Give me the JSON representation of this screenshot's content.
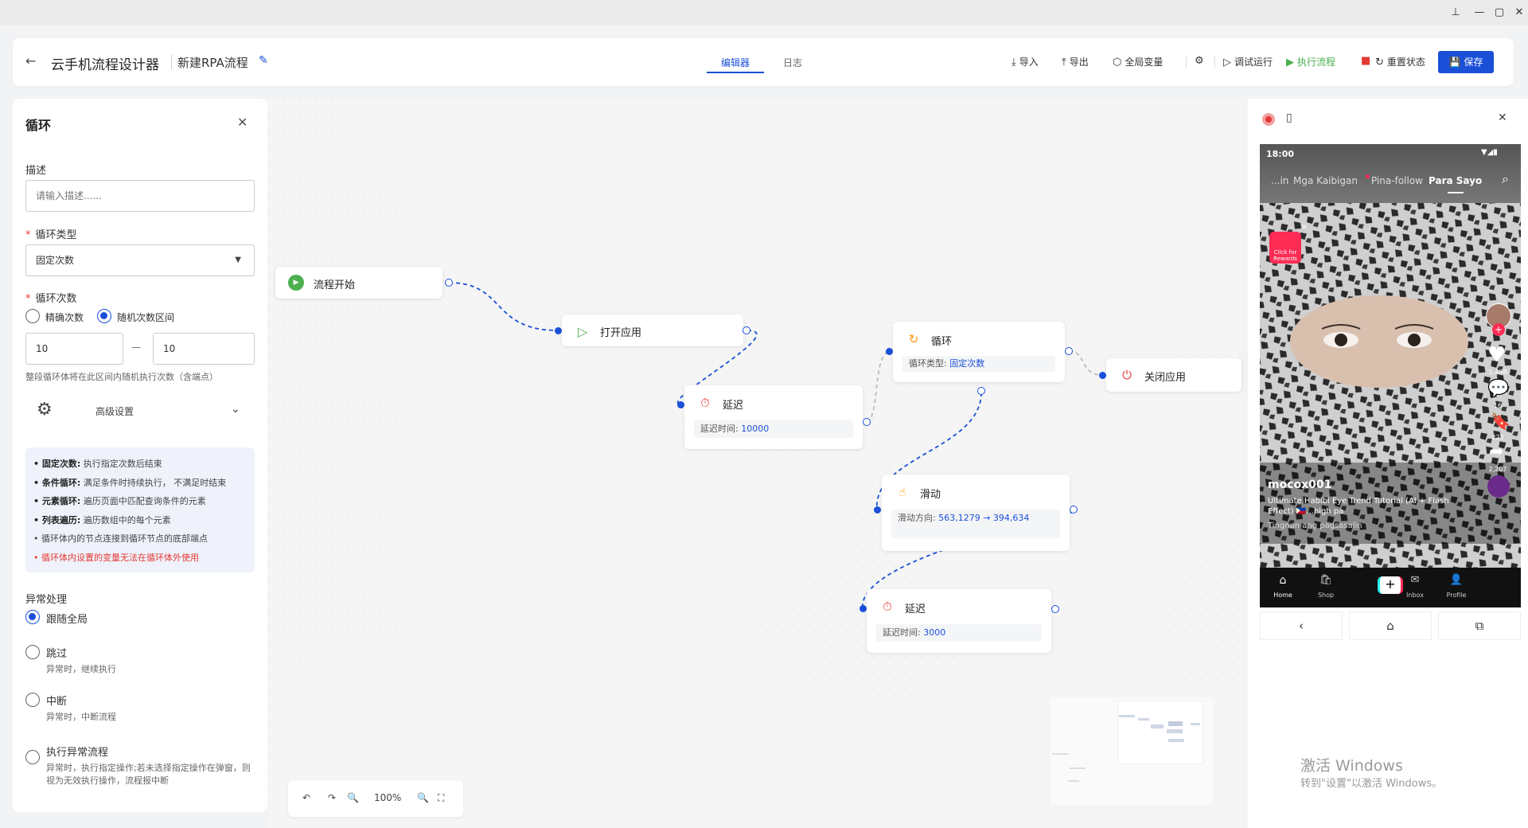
{
  "window": {
    "pin_icon": "pin-icon",
    "min_icon": "minimize-icon",
    "max_icon": "maximize-icon",
    "close_icon": "close-icon"
  },
  "header": {
    "title": "云手机流程设计器",
    "subtitle": "新建RPA流程",
    "tabs": [
      {
        "label": "编辑器",
        "active": true
      },
      {
        "label": "日志",
        "active": false
      }
    ],
    "toolbar": {
      "import": "导入",
      "export": "导出",
      "global_vars": "全局变量",
      "debug_run": "调试运行",
      "execute": "执行流程",
      "reset": "重置状态",
      "save": "保存"
    },
    "accent": "#1a4fd8"
  },
  "left_panel": {
    "title": "循环",
    "desc_label": "描述",
    "desc_placeholder": "请输入描述......",
    "loop_type_label": "循环类型",
    "loop_type_value": "固定次数",
    "loop_count_label": "循环次数",
    "radio_exact": "精确次数",
    "radio_random": "随机次数区间",
    "range_min": "10",
    "range_max": "10",
    "range_dash": "—",
    "range_hint": "整段循环体将在此区间内随机执行次数（含端点）",
    "advanced": "高级设置",
    "info": [
      {
        "k": "• 固定次数:",
        "v": "执行指定次数后结束"
      },
      {
        "k": "• 条件循环:",
        "v": "满足条件时持续执行， 不满足时结束"
      },
      {
        "k": "• 元素循环:",
        "v": "遍历页面中匹配查询条件的元素"
      },
      {
        "k": "• 列表遍历:",
        "v": "遍历数组中的每个元素"
      },
      {
        "k": "",
        "v": "• 循环体内的节点连接到循环节点的底部端点"
      },
      {
        "k": "",
        "v": "• 循环体内设置的变量无法在循环体外使用"
      }
    ],
    "exception_label": "异常处理",
    "exception_options": [
      {
        "label": "跟随全局",
        "desc": ""
      },
      {
        "label": "跳过",
        "desc": "异常时，继续执行"
      },
      {
        "label": "中断",
        "desc": "异常时，中断流程"
      },
      {
        "label": "执行异常流程",
        "desc": "异常时，执行指定操作;若未选择指定操作在弹窗，则视为无效执行操作，流程报中断"
      }
    ]
  },
  "flow_nodes": {
    "start": {
      "title": "流程开始"
    },
    "open_app": {
      "title": "打开应用"
    },
    "delay1": {
      "title": "延迟",
      "detail_key": "延迟时间:",
      "detail_val": "10000"
    },
    "loop": {
      "title": "循环",
      "detail_key": "循环类型:",
      "detail_val": "固定次数"
    },
    "close_app": {
      "title": "关闭应用"
    },
    "swipe": {
      "title": "滑动",
      "detail_key": "滑动方向:",
      "detail_val": "563,1279 → 394,634"
    },
    "delay2": {
      "title": "延迟",
      "detail_key": "延迟时间:",
      "detail_val": "3000"
    }
  },
  "zoom": {
    "level": "100%"
  },
  "phone": {
    "time": "18:00",
    "tabs": [
      "...in",
      "Mga Kaibigan",
      "Pina-follow",
      "Para Sayo"
    ],
    "username": "mocox001",
    "caption": "Ultimate Habibi Eye Trend Tutorial (AI + Flash Effect) 🇵🇭...high pa",
    "sound": "Tingnan ang pagsasalin",
    "likes": "1,498",
    "comments": "16",
    "saves": "223",
    "shares": "2,207",
    "badge": "Click for Rewards",
    "nav": [
      "Home",
      "Shop",
      "",
      "Inbox",
      "Profile"
    ]
  },
  "watermark": {
    "line1": "激活 Windows",
    "line2": "转到\"设置\"以激活 Windows。"
  }
}
